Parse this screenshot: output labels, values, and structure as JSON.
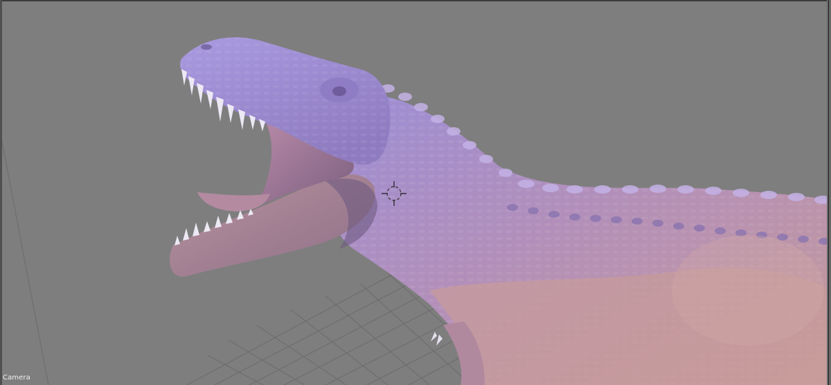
{
  "viewport": {
    "label": "Camera",
    "background_color": "#7e7e7e",
    "grid_color": "#6a6a6a",
    "model_name": "t-rex-sculpt",
    "model_colors": {
      "lit": "#a898d8",
      "mid": "#b890b0",
      "warm": "#c89a96",
      "shadow": "#6c5a78",
      "teeth": "#e8e4f0"
    },
    "cursor_icon": "3d-cursor-icon"
  }
}
